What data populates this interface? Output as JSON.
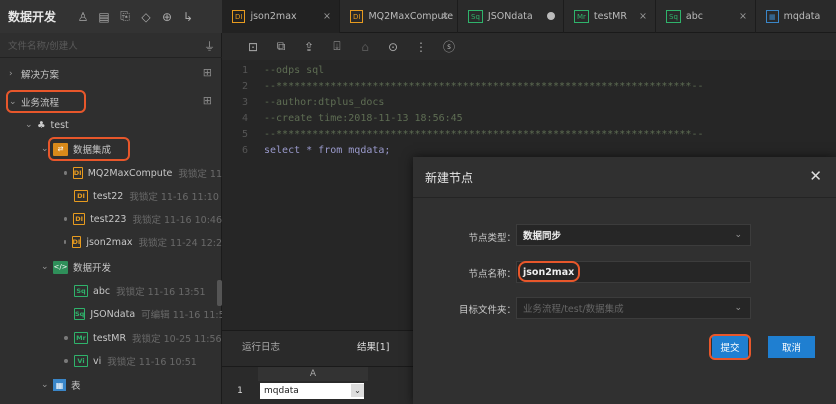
{
  "sidebar": {
    "title": "数据开发",
    "search_placeholder": "文件名称/创建人",
    "tree": {
      "solutions": "解决方案",
      "workflow": "业务流程",
      "test": "test",
      "data_integration": "数据集成",
      "integration_items": [
        {
          "badge": "DI",
          "name": "MQ2MaxCompute",
          "meta": "我锁定 11"
        },
        {
          "badge": "DI",
          "name": "test22",
          "meta": "我锁定 11-16 11:10"
        },
        {
          "badge": "DI",
          "name": "test223",
          "meta": "我锁定 11-16 10:46"
        },
        {
          "badge": "DI",
          "name": "json2max",
          "meta": "我锁定 11-24 12:2"
        }
      ],
      "data_dev": "数据开发",
      "dev_items": [
        {
          "badge": "Sq",
          "name": "abc",
          "meta": "我锁定 11-16 13:51"
        },
        {
          "badge": "Sq",
          "name": "JSONdata",
          "meta": "可编辑 11-16 11:5"
        },
        {
          "badge": "Mr",
          "name": "testMR",
          "meta": "我锁定 10-25 11:56"
        },
        {
          "badge": "Vi",
          "name": "vi",
          "meta": "我锁定 11-16 10:51"
        }
      ],
      "table": "表"
    }
  },
  "tabs": [
    {
      "badge": "DI",
      "label": "json2max"
    },
    {
      "badge": "DI",
      "label": "MQ2MaxCompute"
    },
    {
      "badge": "Sq",
      "label": "JSONdata"
    },
    {
      "badge": "Mr",
      "label": "testMR"
    },
    {
      "badge": "Sq",
      "label": "abc"
    },
    {
      "badge": "▦",
      "label": "mqdata"
    }
  ],
  "editor": {
    "lines": [
      {
        "n": "1",
        "text": "--odps sql",
        "cls": "cm"
      },
      {
        "n": "2",
        "text": "--*********************************************************************--",
        "cls": "cm"
      },
      {
        "n": "3",
        "text": "--author:dtplus_docs",
        "cls": "cm"
      },
      {
        "n": "4",
        "text": "--create time:2018-11-13 18:56:45",
        "cls": "cm"
      },
      {
        "n": "5",
        "text": "--*********************************************************************--",
        "cls": "cm"
      },
      {
        "n": "6",
        "text": "select * from mqdata;",
        "cls": "kw"
      }
    ]
  },
  "bottom": {
    "tab_log": "运行日志",
    "tab_result": "结果[1]",
    "column_header": "A",
    "row_number": "1",
    "cell_value": "mqdata"
  },
  "dialog": {
    "title": "新建节点",
    "type_label": "节点类型：",
    "type_value": "数据同步",
    "name_label": "节点名称：",
    "name_value": "json2max",
    "folder_label": "目标文件夹：",
    "folder_value": "业务流程/test/数据集成",
    "submit": "提交",
    "cancel": "取消"
  },
  "colors": {
    "accent": "#1f7fd1",
    "highlight": "#e8572b",
    "di": "#e79b1f",
    "sq": "#2fb36b"
  }
}
